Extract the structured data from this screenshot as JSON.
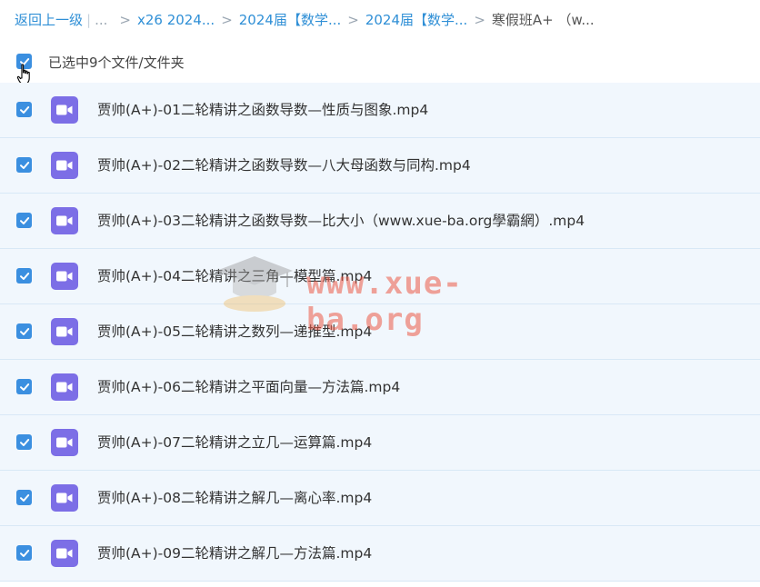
{
  "breadcrumb": {
    "back": "返回上一级",
    "ellipsis": "...",
    "items": [
      "x26 2024...",
      "2024届【数学...",
      "2024届【数学..."
    ],
    "current": "寒假班A+ （w..."
  },
  "selection": {
    "text": "已选中9个文件/文件夹",
    "checked": true
  },
  "files": [
    {
      "name": "贾帅(A+)-01二轮精讲之函数导数—性质与图象.mp4",
      "checked": true,
      "icon": "video-file-icon"
    },
    {
      "name": "贾帅(A+)-02二轮精讲之函数导数—八大母函数与同构.mp4",
      "checked": true,
      "icon": "video-file-icon"
    },
    {
      "name": "贾帅(A+)-03二轮精讲之函数导数—比大小（www.xue-ba.org學霸網）.mp4",
      "checked": true,
      "icon": "video-file-icon"
    },
    {
      "name": "贾帅(A+)-04二轮精讲之三角—模型篇.mp4",
      "checked": true,
      "icon": "video-file-icon"
    },
    {
      "name": "贾帅(A+)-05二轮精讲之数列—递推型.mp4",
      "checked": true,
      "icon": "video-file-icon"
    },
    {
      "name": "贾帅(A+)-06二轮精讲之平面向量—方法篇.mp4",
      "checked": true,
      "icon": "video-file-icon"
    },
    {
      "name": "贾帅(A+)-07二轮精讲之立几—运算篇.mp4",
      "checked": true,
      "icon": "video-file-icon"
    },
    {
      "name": "贾帅(A+)-08二轮精讲之解几—离心率.mp4",
      "checked": true,
      "icon": "video-file-icon"
    },
    {
      "name": "贾帅(A+)-09二轮精讲之解几—方法篇.mp4",
      "checked": true,
      "icon": "video-file-icon"
    }
  ],
  "watermark": {
    "text": "www.xue-ba.org"
  },
  "colors": {
    "accent": "#3b8fe0",
    "link": "#2f8fd6",
    "row_bg": "#f1f7fd",
    "video_icon": "#7c6ee6"
  }
}
